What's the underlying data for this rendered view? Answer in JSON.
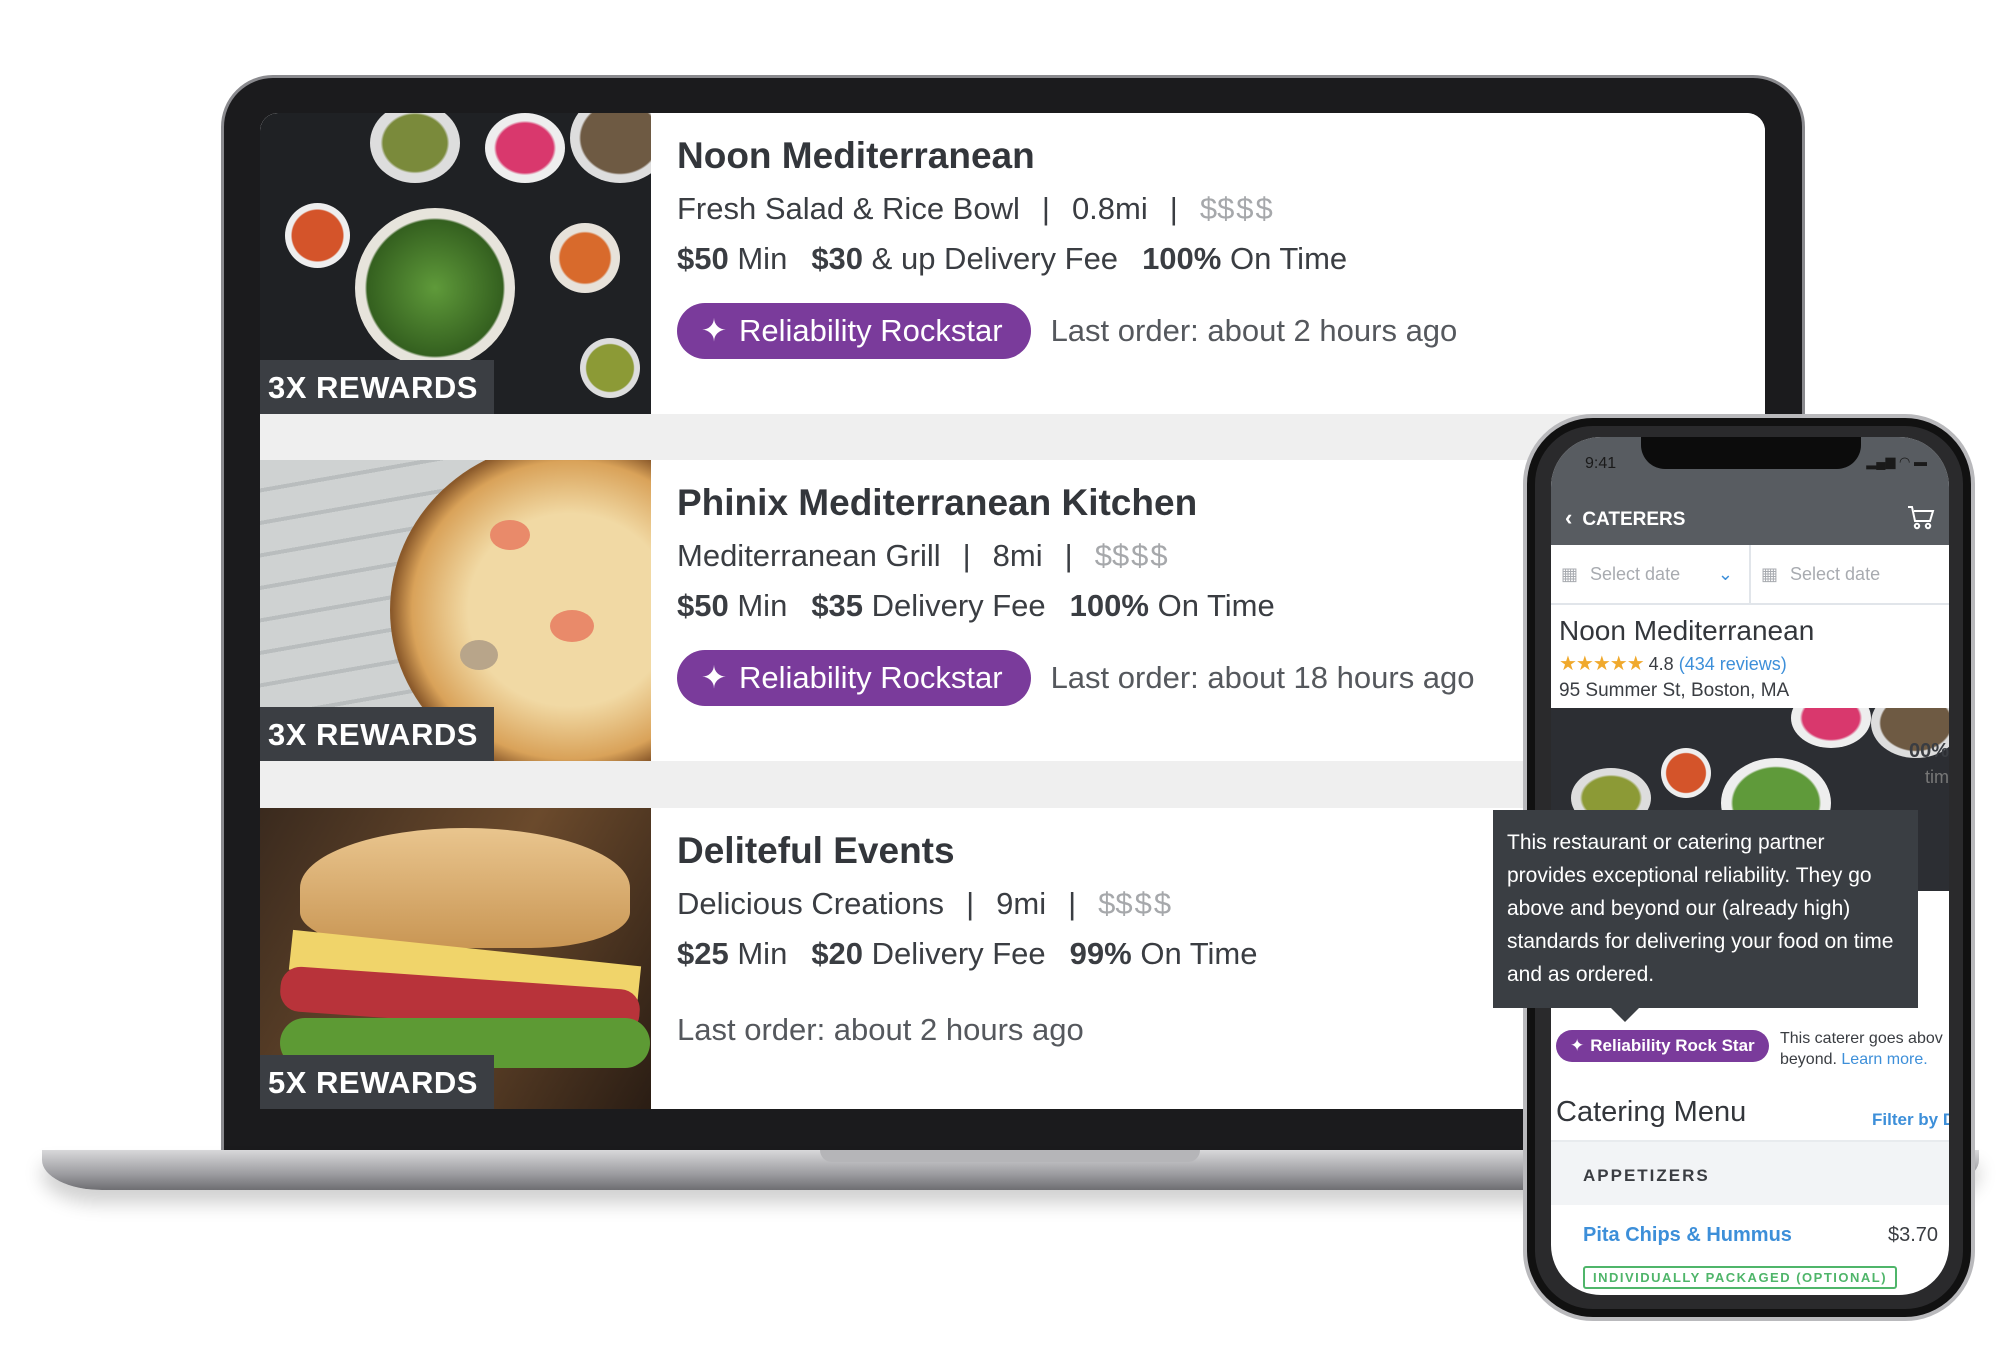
{
  "restaurants": [
    {
      "name": "Noon Mediterranean",
      "cuisine": "Fresh Salad & Rice Bowl",
      "distance": "0.8mi",
      "price_active": "$",
      "price_dim": "$$$",
      "min": "$50",
      "min_label": "Min",
      "fee": "$30",
      "fee_label": "& up Delivery Fee",
      "ontime": "100%",
      "ontime_label": "On Time",
      "badge": "Reliability Rockstar",
      "last_order": "Last order: about 2 hours ago",
      "rewards": "3X REWARDS"
    },
    {
      "name": "Phinix Mediterranean Kitchen",
      "cuisine": "Mediterranean Grill",
      "distance": "8mi",
      "price_active": "$",
      "price_dim": "$$$",
      "min": "$50",
      "min_label": "Min",
      "fee": "$35",
      "fee_label": "Delivery Fee",
      "ontime": "100%",
      "ontime_label": "On Time",
      "badge": "Reliability Rockstar",
      "last_order": "Last order: about 18 hours ago",
      "rewards": "3X REWARDS"
    },
    {
      "name": "Deliteful Events",
      "cuisine": "Delicious Creations",
      "distance": "9mi",
      "price_active": "$",
      "price_dim": "$$$",
      "min": "$25",
      "min_label": "Min",
      "fee": "$20",
      "fee_label": "Delivery Fee",
      "ontime": "99%",
      "ontime_label": "On Time",
      "last_order": "Last order: about 2 hours ago",
      "rewards": "5X REWARDS"
    }
  ],
  "separator": "|",
  "phone": {
    "time": "9:41",
    "back_label": "CATERERS",
    "date_placeholder_1": "Select date",
    "date_placeholder_2": "Select date",
    "title": "Noon Mediterranean",
    "stars": "★★★★★",
    "rating": "4.8",
    "reviews": "(434 reviews)",
    "address": "95 Summer St, Boston, MA",
    "tooltip": "This restaurant or catering partner provides exceptional reliability. They go above and beyond our (already high) standards for delivering your food on time and as ordered.",
    "peek_stat": "00%",
    "peek_label": "tim",
    "badge": "Reliability Rock Star",
    "badge_desc": "This caterer goes abov",
    "badge_desc2": "beyond.",
    "learn_more": "Learn more.",
    "menu_title": "Catering Menu",
    "filter": "Filter by D",
    "section": "APPETIZERS",
    "item": "Pita Chips & Hummus",
    "item_price": "$3.70",
    "item_tag": "INDIVIDUALLY PACKAGED (OPTIONAL)"
  },
  "colors": {
    "badge": "#7a3b9b",
    "link": "#3d8fd9",
    "header": "#585c61",
    "tag": "#4fb56a",
    "star": "#f0a92c"
  }
}
